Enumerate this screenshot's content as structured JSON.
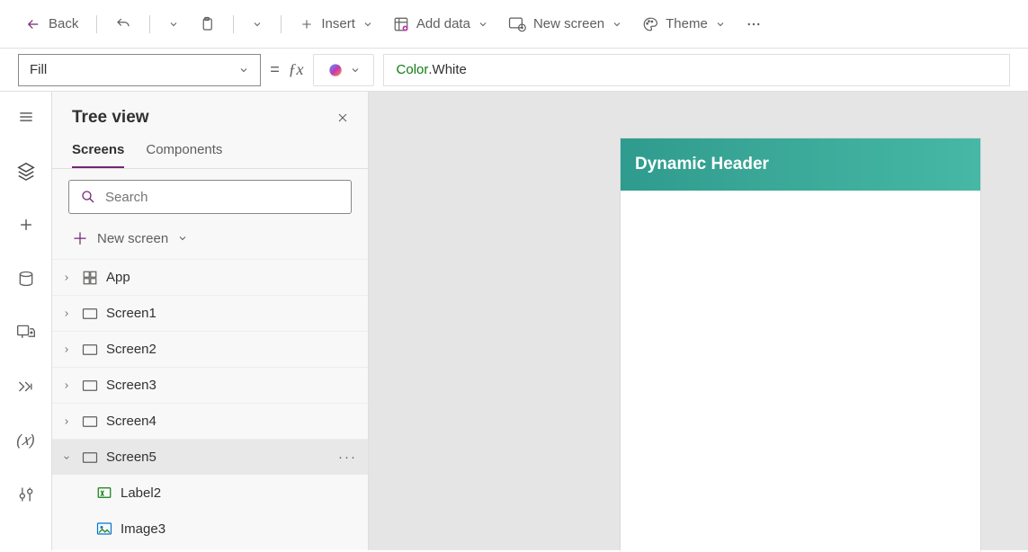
{
  "toolbar": {
    "back": "Back",
    "insert": "Insert",
    "add_data": "Add data",
    "new_screen": "New screen",
    "theme": "Theme"
  },
  "formula": {
    "property": "Fill",
    "token_color": "Color",
    "token_rest": ".White"
  },
  "tree": {
    "title": "Tree view",
    "tabs": {
      "screens": "Screens",
      "components": "Components"
    },
    "search_placeholder": "Search",
    "new_screen": "New screen",
    "items": [
      {
        "label": "App",
        "kind": "app"
      },
      {
        "label": "Screen1",
        "kind": "screen"
      },
      {
        "label": "Screen2",
        "kind": "screen"
      },
      {
        "label": "Screen3",
        "kind": "screen"
      },
      {
        "label": "Screen4",
        "kind": "screen"
      },
      {
        "label": "Screen5",
        "kind": "screen",
        "selected": true,
        "expanded": true
      },
      {
        "label": "Label2",
        "kind": "label",
        "child": true
      },
      {
        "label": "Image3",
        "kind": "image",
        "child": true
      }
    ]
  },
  "canvas": {
    "header_text": "Dynamic Header"
  }
}
